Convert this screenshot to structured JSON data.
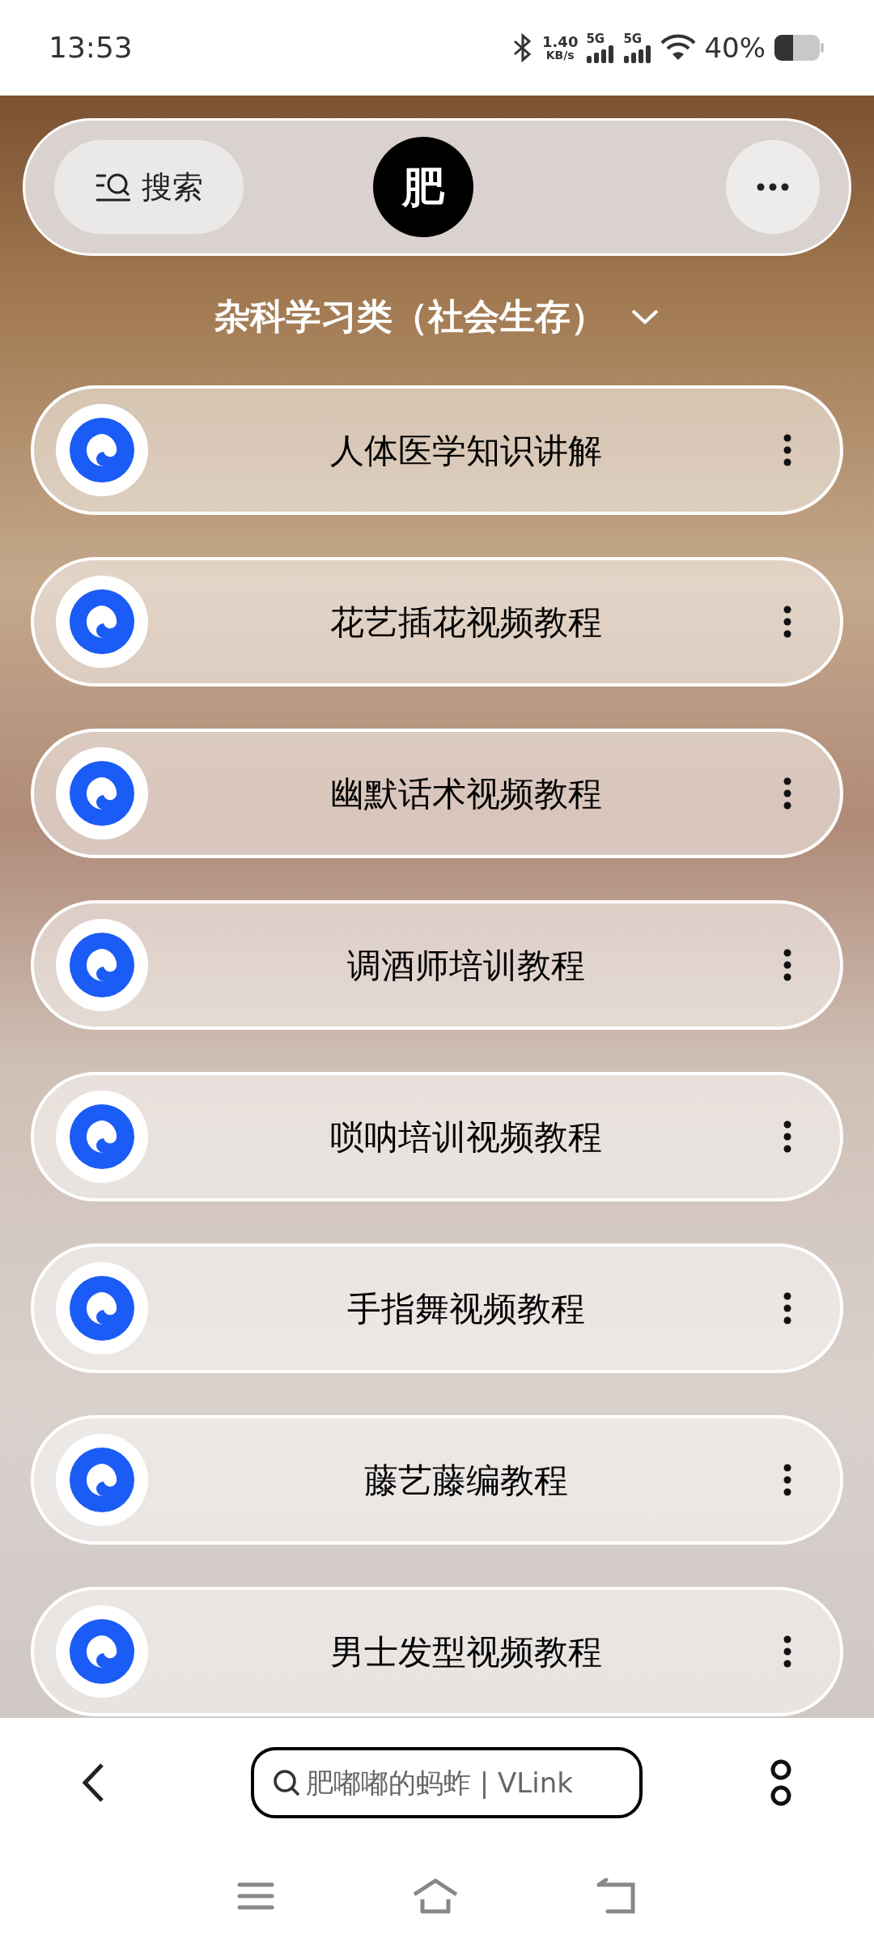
{
  "status_bar": {
    "time": "13:53",
    "net_speed": "1.40",
    "net_unit": "KB/s",
    "sim_labels": [
      "5G",
      "5G"
    ],
    "battery": "40%"
  },
  "header": {
    "search_label": "搜索",
    "avatar_letter": "肥"
  },
  "category": {
    "title": "杂科学习类（社会生存）"
  },
  "items": [
    {
      "title": "人体医学知识讲解"
    },
    {
      "title": "花艺插花视频教程"
    },
    {
      "title": "幽默话术视频教程"
    },
    {
      "title": "调酒师培训教程"
    },
    {
      "title": "唢呐培训视频教程"
    },
    {
      "title": "手指舞视频教程"
    },
    {
      "title": "藤艺藤编教程"
    },
    {
      "title": "男士发型视频教程"
    }
  ],
  "browser_bar": {
    "address": "肥嘟嘟的蚂蚱 | VLink"
  }
}
